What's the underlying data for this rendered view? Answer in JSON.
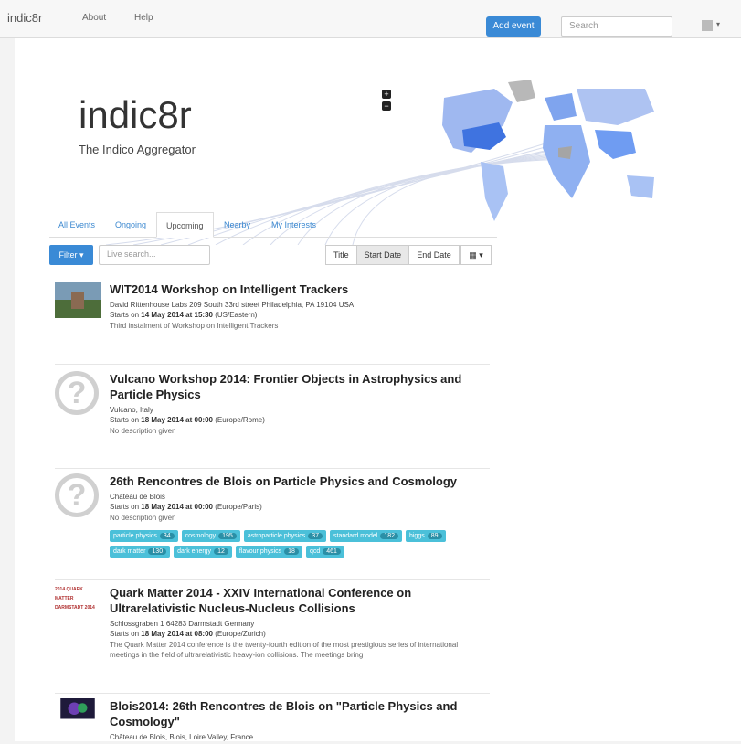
{
  "navbar": {
    "brand": "indic8r",
    "links": [
      "About",
      "Help"
    ],
    "add_event": "Add event",
    "search_placeholder": "Search"
  },
  "hero": {
    "title": "indic8r",
    "subtitle": "The Indico Aggregator",
    "zoom_in": "+",
    "zoom_out": "−"
  },
  "tabs": [
    {
      "label": "All Events",
      "active": false
    },
    {
      "label": "Ongoing",
      "active": false
    },
    {
      "label": "Upcoming",
      "active": true
    },
    {
      "label": "Nearby",
      "active": false
    },
    {
      "label": "My Interests",
      "active": false
    }
  ],
  "toolbar": {
    "filter_label": "Filter",
    "live_search_placeholder": "Live search...",
    "sort_options": [
      "Title",
      "Start Date",
      "End Date"
    ],
    "active_sort": "Start Date"
  },
  "events": [
    {
      "title": "WIT2014 Workshop on Intelligent Trackers",
      "location": "David Rittenhouse Labs 209 South 33rd street Philadelphia, PA 19104 USA",
      "start_prefix": "Starts on ",
      "start_date": "14 May 2014 at 15:30",
      "timezone": " (US/Eastern)",
      "description": "Third instalment of Workshop on Intelligent Trackers",
      "thumb": "photo"
    },
    {
      "title": "Vulcano Workshop 2014: Frontier Objects in Astrophysics and Particle Physics",
      "location": "Vulcano, Italy",
      "start_prefix": "Starts on ",
      "start_date": "18 May 2014 at 00:00",
      "timezone": " (Europe/Rome)",
      "description": "No description given",
      "thumb": "question"
    },
    {
      "title": "26th Rencontres de Blois on Particle Physics and Cosmology",
      "location": "Chateau de Blois",
      "start_prefix": "Starts on ",
      "start_date": "18 May 2014 at 00:00",
      "timezone": " (Europe/Paris)",
      "description": "No description given",
      "thumb": "question",
      "tags": [
        {
          "name": "particle physics",
          "count": "34"
        },
        {
          "name": "cosmology",
          "count": "195"
        },
        {
          "name": "astroparticle physics",
          "count": "37"
        },
        {
          "name": "standard model",
          "count": "182"
        },
        {
          "name": "higgs",
          "count": "89"
        },
        {
          "name": "dark matter",
          "count": "130"
        },
        {
          "name": "dark energy",
          "count": "12"
        },
        {
          "name": "flavour physics",
          "count": "18"
        },
        {
          "name": "qcd",
          "count": "461"
        }
      ]
    },
    {
      "title": "Quark Matter 2014 - XXIV International Conference on Ultrarelativistic Nucleus-Nucleus Collisions",
      "location": "Schlossgraben 1 64283 Darmstadt Germany",
      "start_prefix": "Starts on ",
      "start_date": "18 May 2014 at 08:00",
      "timezone": " (Europe/Zurich)",
      "description": "The Quark Matter 2014 conference is the twenty-fourth edition of the most prestigious series of international meetings in the field of ultrarelativistic heavy-ion collisions. The meetings bring",
      "thumb": "logo",
      "logo_text": "2014 QUARK MATTER DARMSTADT 2014"
    },
    {
      "title": "Blois2014: 26th Rencontres de Blois on \"Particle Physics and Cosmology\"",
      "location": "Château de Blois, Blois, Loire Valley, France",
      "thumb": "photo2"
    }
  ],
  "colors": {
    "primary": "#3a8ad6",
    "tag": "#4bc0d9",
    "map_highlight": "#6f9cf2"
  }
}
